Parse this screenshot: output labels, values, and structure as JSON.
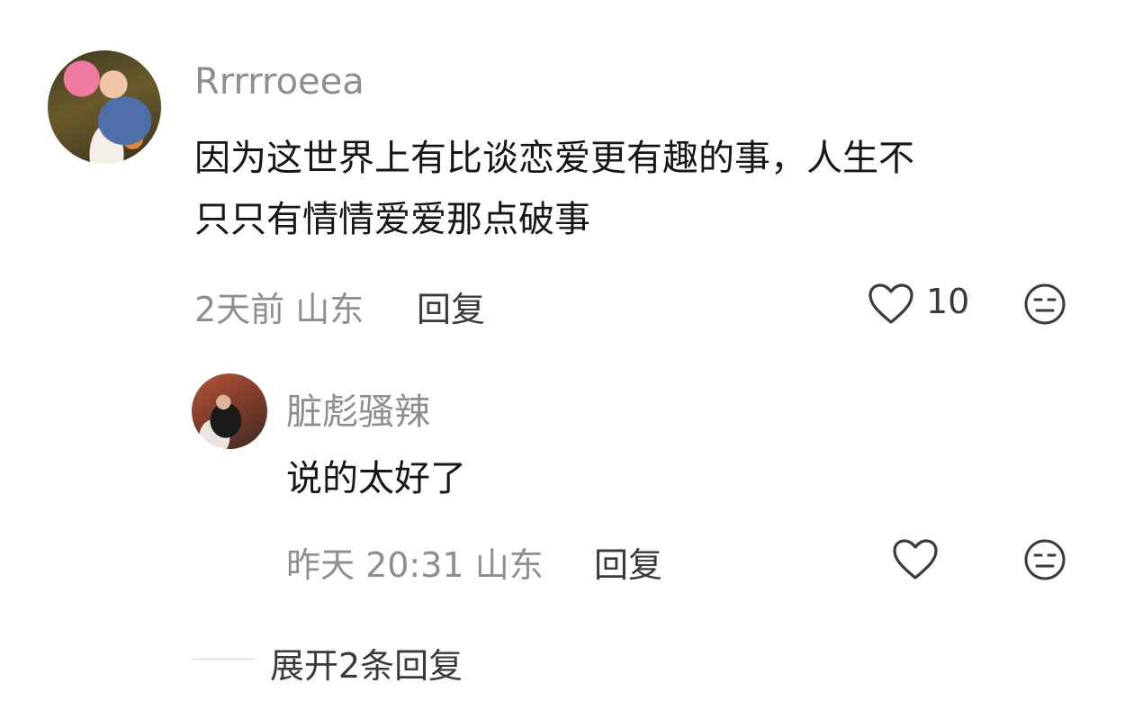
{
  "comment": {
    "username": "Rrrrroeea",
    "text_line1": "因为这世界上有比谈恋爱更有趣的事，人生不",
    "text_line2": "只只有情情爱爱那点破事",
    "time": "2天前",
    "location": "山东",
    "reply_label": "回复",
    "like_count": "10",
    "heart_icon": "heart-outline-icon",
    "dislike_icon": "meh-face-icon"
  },
  "reply": {
    "username": "脏彪骚辣",
    "text": "说的太好了",
    "time": "昨天 20:31",
    "location": "山东",
    "reply_label": "回复",
    "heart_icon": "heart-outline-icon",
    "dislike_icon": "meh-face-icon"
  },
  "expand": {
    "label": "展开2条回复"
  },
  "colors": {
    "muted": "#8e8e8e",
    "text": "#161616",
    "action": "#3a3a3a"
  }
}
